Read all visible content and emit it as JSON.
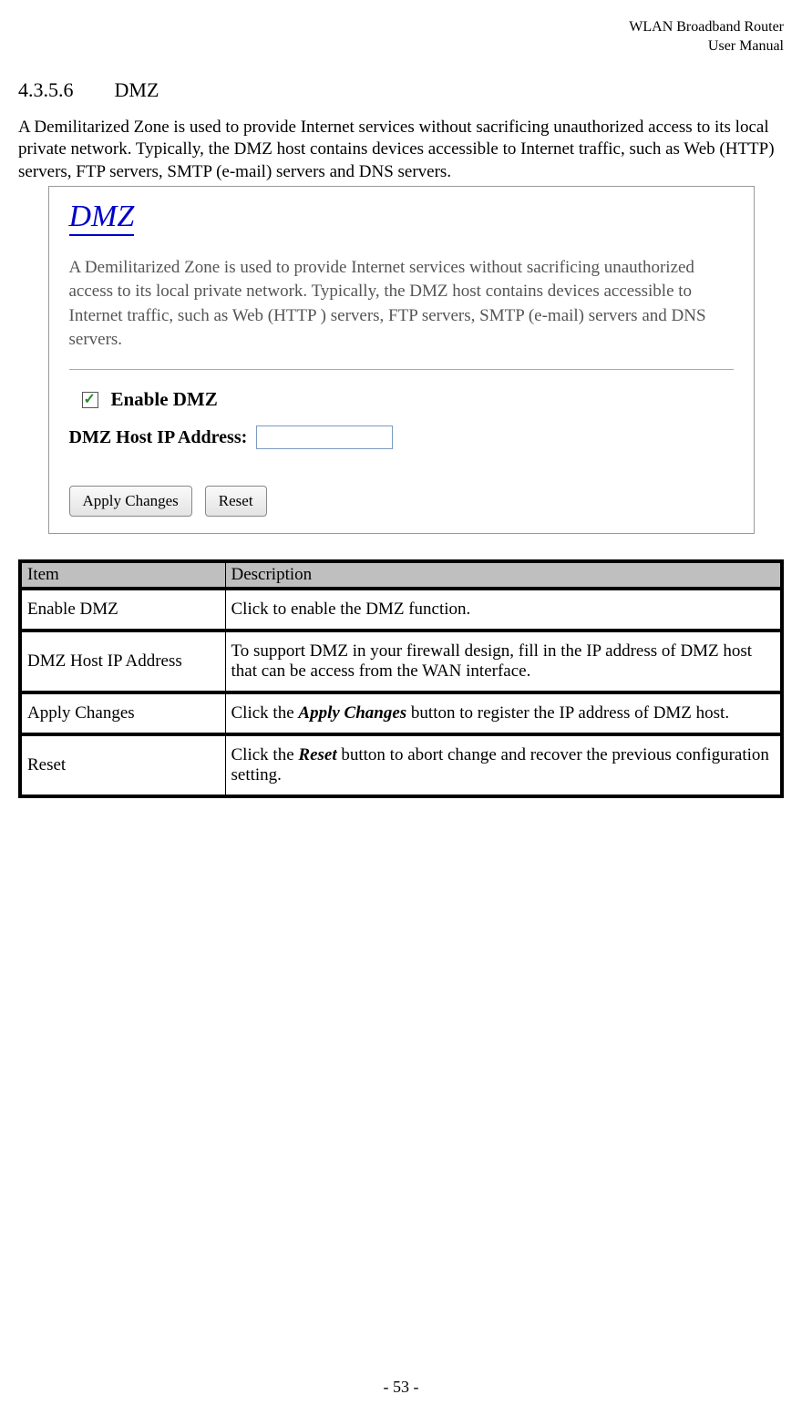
{
  "header": {
    "line1": "WLAN  Broadband  Router",
    "line2": "User  Manual"
  },
  "section": {
    "number": "4.3.5.6",
    "title": "DMZ"
  },
  "intro": "A Demilitarized Zone is used to provide Internet services without sacrificing unauthorized access to its local private network. Typically, the DMZ host contains devices accessible to Internet traffic, such as Web (HTTP) servers, FTP servers, SMTP (e-mail) servers and DNS servers.",
  "screenshot": {
    "title": "DMZ",
    "desc": "A Demilitarized Zone is used to provide Internet services without sacrificing unauthorized access to its local private network. Typically, the DMZ host contains devices accessible to Internet traffic, such as Web (HTTP ) servers, FTP servers, SMTP (e-mail) servers and DNS servers.",
    "enable_label": "Enable DMZ",
    "ip_label": "DMZ Host IP Address:",
    "ip_value": "",
    "apply_btn": "Apply Changes",
    "reset_btn": "Reset"
  },
  "table": {
    "header_item": "Item",
    "header_desc": "Description",
    "rows": [
      {
        "item": "Enable DMZ",
        "desc": "Click to enable the DMZ function."
      },
      {
        "item": "DMZ Host IP Address",
        "desc": "To support DMZ in your firewall design, fill in the IP address of DMZ host that can be access from the WAN interface."
      },
      {
        "item": "Apply Changes",
        "desc_pre": "Click the ",
        "desc_bold": "Apply Changes",
        "desc_post": " button to register the IP address of DMZ host."
      },
      {
        "item": "Reset",
        "desc_pre": "Click the ",
        "desc_bold": "Reset",
        "desc_post": " button to abort change and recover the previous configuration setting."
      }
    ]
  },
  "footer": "- 53 -"
}
